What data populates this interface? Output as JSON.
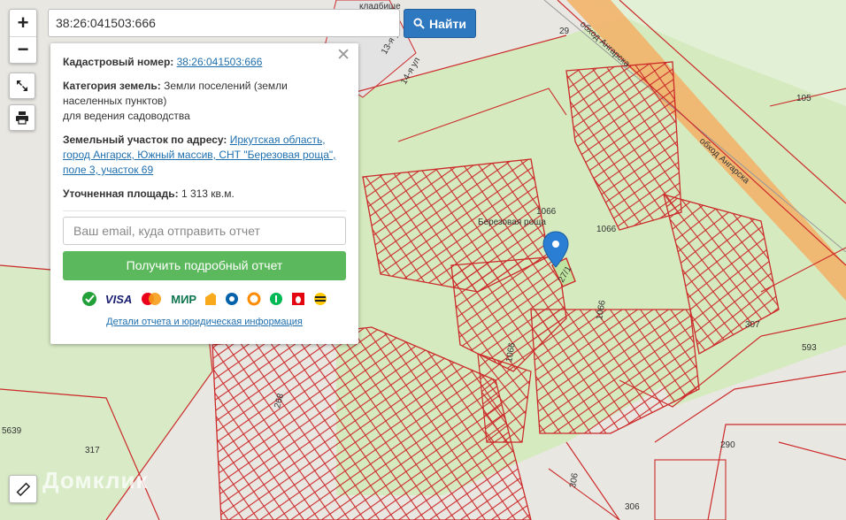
{
  "search": {
    "value": "38:26:041503:666",
    "button_label": "Найти"
  },
  "zoom": {
    "in_label": "+",
    "out_label": "−"
  },
  "panel": {
    "cadastral_label": "Кадастровый номер:",
    "cadastral_value": "38:26:041503:666",
    "category_label": "Категория земель:",
    "category_value_1": "Земли поселений (земли",
    "category_value_2": "населенных пунктов)",
    "category_value_3": "для ведения садоводства",
    "address_label": "Земельный участок по адресу:",
    "address_value_1": "Иркутская область,",
    "address_value_2": "город Ангарск, Южный массив, СНТ \"Березовая роща\",",
    "address_value_3": "поле 3, участок 69",
    "area_label": "Уточненная площадь:",
    "area_value": "1 313 кв.м.",
    "email_placeholder": "Ваш email, куда отправить отчет",
    "report_button": "Получить подробный отчет",
    "details_link": "Детали отчета и юридическая информация"
  },
  "payment_icons": [
    "sberbank-icon",
    "visa-icon",
    "mastercard-icon",
    "mir-icon",
    "yandex-money-icon",
    "webmoney-icon",
    "qiwi-icon",
    "megafon-icon",
    "mts-icon",
    "beeline-icon"
  ],
  "payment_text": {
    "visa": "VISA",
    "mir": "МИР"
  },
  "map_labels": {
    "road_1": "обход Ангарска",
    "road_2": "обход Ангарска",
    "n29": "29",
    "n105": "105",
    "n1066a": "1066",
    "n1066b": "1066",
    "n1066c": "1066",
    "n1066d": "1066",
    "n271": "27/1",
    "n307": "307",
    "n593": "593",
    "n290": "290",
    "n306a": "306",
    "n306b": "306",
    "n317": "317",
    "n5639": "5639",
    "n268": "268",
    "roscha": "Березовая роща",
    "street_13": "13-я ул",
    "street_14": "14-я ул",
    "cemetery": "кладбище"
  },
  "brand": "Домклик",
  "colors": {
    "map_bg": "#e9e7e2",
    "green_area": "#d5eabf",
    "parcel_line": "#cc2a2a",
    "road": "#f2b36a",
    "accent": "#2e78c0",
    "report_btn": "#5cb85c"
  }
}
